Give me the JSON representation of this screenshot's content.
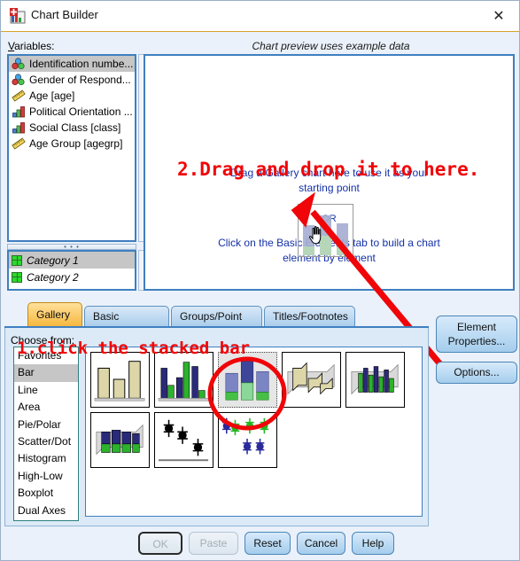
{
  "window": {
    "title": "Chart Builder",
    "icon": "chart-builder-icon",
    "close_label": "✕"
  },
  "labels": {
    "variables": "Variables:",
    "variables_mnemonic": "V",
    "preview_caption": "Chart preview uses example data",
    "choose_from": "Choose from:"
  },
  "variables": [
    {
      "label": "Identification numbe...",
      "icon": "nominal-icon",
      "selected": true
    },
    {
      "label": "Gender of Respond...",
      "icon": "nominal-icon",
      "selected": false
    },
    {
      "label": "Age [age]",
      "icon": "scale-icon",
      "selected": false
    },
    {
      "label": "Political Orientation ...",
      "icon": "ordinal-icon",
      "selected": false
    },
    {
      "label": "Social Class [class]",
      "icon": "ordinal-icon",
      "selected": false
    },
    {
      "label": "Age Group [agegrp]",
      "icon": "scale-icon",
      "selected": false
    }
  ],
  "categories": [
    {
      "label": "Category 1",
      "icon": "category-grid-icon",
      "selected": true
    },
    {
      "label": "Category 2",
      "icon": "category-grid-icon",
      "selected": false
    }
  ],
  "preview": {
    "line1": "Drag a Gallery chart here to use it as your",
    "line2": "starting point",
    "or": "OR",
    "line3": "Click on the Basic Elements tab to build a chart",
    "line4": "element by element"
  },
  "annotations": {
    "step1": "1.click the stacked bar",
    "step2": "2.Drag and drop it to here.",
    "color": "#f00508"
  },
  "tabs": [
    {
      "label": "Gallery",
      "active": true
    },
    {
      "label": "Basic Elements",
      "active": false
    },
    {
      "label": "Groups/Point ID",
      "active": false
    },
    {
      "label": "Titles/Footnotes",
      "active": false
    }
  ],
  "chart_types": [
    {
      "label": "Favorites",
      "selected": false
    },
    {
      "label": "Bar",
      "selected": true
    },
    {
      "label": "Line",
      "selected": false
    },
    {
      "label": "Area",
      "selected": false
    },
    {
      "label": "Pie/Polar",
      "selected": false
    },
    {
      "label": "Scatter/Dot",
      "selected": false
    },
    {
      "label": "Histogram",
      "selected": false
    },
    {
      "label": "High-Low",
      "selected": false
    },
    {
      "label": "Boxplot",
      "selected": false
    },
    {
      "label": "Dual Axes",
      "selected": false
    }
  ],
  "gallery_thumbs": [
    {
      "name": "simple-bar",
      "selected": false
    },
    {
      "name": "clustered-bar",
      "selected": false
    },
    {
      "name": "stacked-bar",
      "selected": true
    },
    {
      "name": "simple-3d-bar",
      "selected": false
    },
    {
      "name": "clustered-3d-bar",
      "selected": false
    },
    {
      "name": "stacked-3d-bar",
      "selected": false
    },
    {
      "name": "simple-error-bar",
      "selected": false
    },
    {
      "name": "clustered-error-bar",
      "selected": false
    }
  ],
  "side_buttons": {
    "element_properties_l1": "Element",
    "element_properties_l2": "Properties...",
    "options": "Options..."
  },
  "bottom_buttons": [
    {
      "label": "OK",
      "enabled": false,
      "default": true
    },
    {
      "label": "Paste",
      "enabled": false,
      "default": false
    },
    {
      "label": "Reset",
      "enabled": true,
      "default": false
    },
    {
      "label": "Cancel",
      "enabled": true,
      "default": false
    },
    {
      "label": "Help",
      "enabled": true,
      "default": false
    }
  ]
}
